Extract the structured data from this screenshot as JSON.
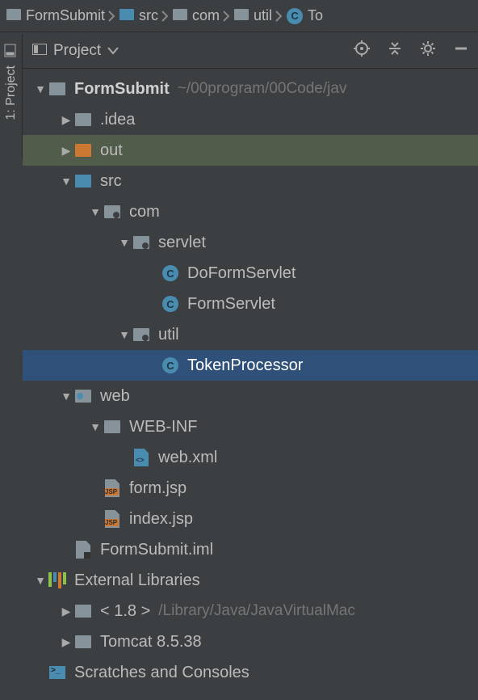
{
  "breadcrumbs": [
    {
      "label": "FormSubmit",
      "icon": "module"
    },
    {
      "label": "src",
      "icon": "folder-bluebg"
    },
    {
      "label": "com",
      "icon": "folder"
    },
    {
      "label": "util",
      "icon": "folder"
    },
    {
      "label": "To",
      "icon": "class",
      "truncated": true
    }
  ],
  "sidebar": {
    "tab_number": "1:",
    "tab_label": "Project"
  },
  "panel": {
    "title": "Project"
  },
  "tree": {
    "root": {
      "label": "FormSubmit",
      "path": "~/00program/00Code/jav"
    },
    "idea": ".idea",
    "out": "out",
    "src": "src",
    "com": "com",
    "servlet": "servlet",
    "doformservlet": "DoFormServlet",
    "formservlet": "FormServlet",
    "util": "util",
    "tokenprocessor": "TokenProcessor",
    "web": "web",
    "webinf": "WEB-INF",
    "webxml": "web.xml",
    "formjsp": "form.jsp",
    "indexjsp": "index.jsp",
    "iml": "FormSubmit.iml",
    "external": "External Libraries",
    "jdk_label": "< 1.8 >",
    "jdk_path": "/Library/Java/JavaVirtualMac",
    "tomcat": "Tomcat 8.5.38",
    "scratches": "Scratches and Consoles"
  }
}
